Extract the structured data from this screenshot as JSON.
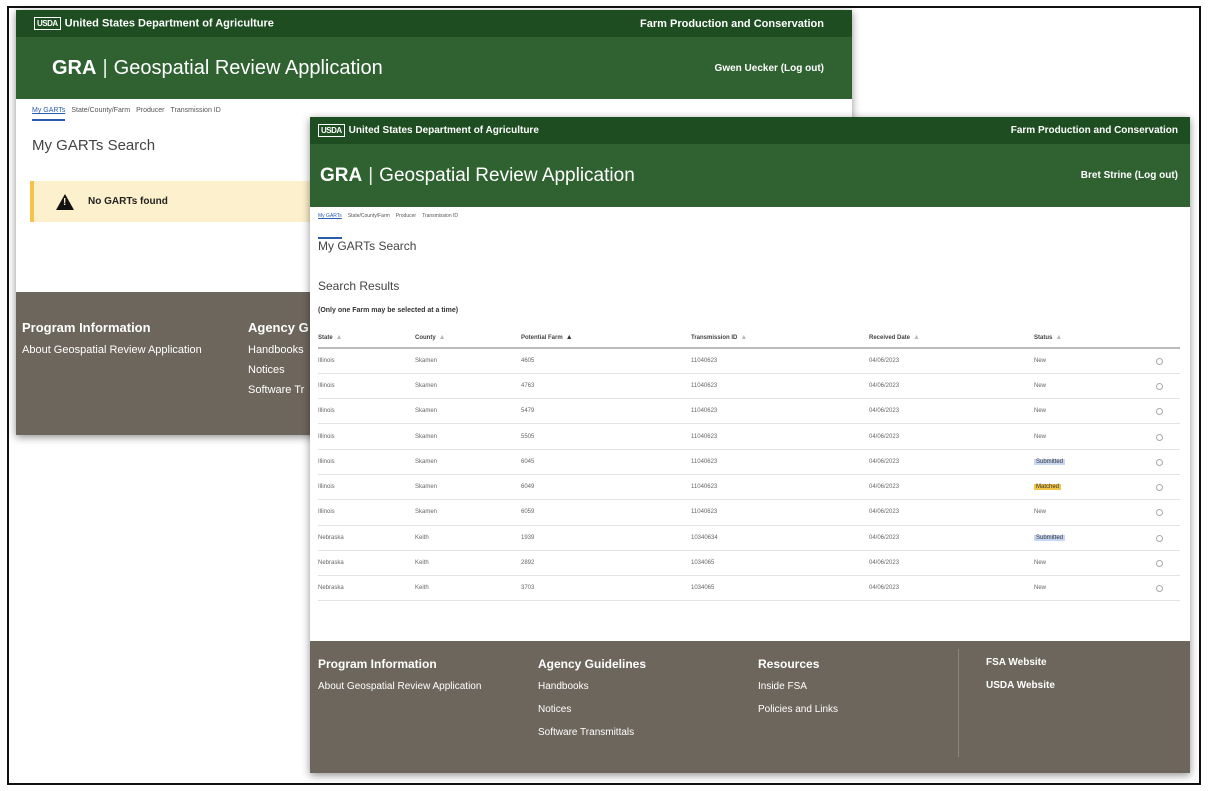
{
  "back": {
    "agency": "United States Department of Agriculture",
    "logo": "USDA",
    "mission_area": "Farm Production and Conservation",
    "brand_short": "GRA",
    "brand_sep": "|",
    "brand_app": "Geospatial Review Application",
    "user": "Gwen Uecker (Log out)",
    "nav": [
      "My GARTs",
      "State/County/Farm",
      "Producer",
      "Transmission ID"
    ],
    "page_title": "My GARTs Search",
    "alert_text": "No GARTs found",
    "footer": {
      "program_head": "Program Information",
      "program_link": "About Geospatial Review Application",
      "agency_head": "Agency G",
      "agency_links": [
        "Handbooks",
        "Notices",
        "Software Tr"
      ]
    }
  },
  "front": {
    "agency": "United States Department of Agriculture",
    "logo": "USDA",
    "mission_area": "Farm Production and Conservation",
    "brand_short": "GRA",
    "brand_sep": "|",
    "brand_app": "Geospatial Review Application",
    "user": "Bret Strine (Log out)",
    "nav": [
      "My GARTs",
      "State/County/Farm",
      "Producer",
      "Transmission ID"
    ],
    "page_title": "My GARTs Search",
    "results_title": "Search Results",
    "note": "(Only one Farm may be selected at a time)",
    "columns": [
      "State",
      "County",
      "Potential Farm",
      "Transmission ID",
      "Received Date",
      "Status"
    ],
    "rows": [
      {
        "state": "Illinois",
        "county": "Skamen",
        "farm": "4605",
        "tid": "11040623",
        "date": "04/06/2023",
        "status": "New",
        "kind": "new"
      },
      {
        "state": "Illinois",
        "county": "Skamen",
        "farm": "4763",
        "tid": "11040623",
        "date": "04/06/2023",
        "status": "New",
        "kind": "new"
      },
      {
        "state": "Illinois",
        "county": "Skamen",
        "farm": "5479",
        "tid": "11040623",
        "date": "04/06/2023",
        "status": "New",
        "kind": "new"
      },
      {
        "state": "Illinois",
        "county": "Skamen",
        "farm": "5505",
        "tid": "11040623",
        "date": "04/06/2023",
        "status": "New",
        "kind": "new"
      },
      {
        "state": "Illinois",
        "county": "Skamen",
        "farm": "6045",
        "tid": "11040623",
        "date": "04/06/2023",
        "status": "Submitted",
        "kind": "submitted"
      },
      {
        "state": "Illinois",
        "county": "Skamen",
        "farm": "6049",
        "tid": "11040623",
        "date": "04/06/2023",
        "status": "Matched",
        "kind": "matched"
      },
      {
        "state": "Illinois",
        "county": "Skamen",
        "farm": "6059",
        "tid": "11040623",
        "date": "04/06/2023",
        "status": "New",
        "kind": "new"
      },
      {
        "state": "Nebraska",
        "county": "Keith",
        "farm": "1939",
        "tid": "10340634",
        "date": "04/06/2023",
        "status": "Submitted",
        "kind": "submitted"
      },
      {
        "state": "Nebraska",
        "county": "Keith",
        "farm": "2892",
        "tid": "1034065",
        "date": "04/06/2023",
        "status": "New",
        "kind": "new"
      },
      {
        "state": "Nebraska",
        "county": "Keith",
        "farm": "3703",
        "tid": "1034065",
        "date": "04/06/2023",
        "status": "New",
        "kind": "new"
      }
    ],
    "footer": {
      "program_head": "Program Information",
      "program_link": "About Geospatial Review Application",
      "agency_head": "Agency Guidelines",
      "agency_links": [
        "Handbooks",
        "Notices",
        "Software Transmittals"
      ],
      "resources_head": "Resources",
      "resources_links": [
        "Inside FSA",
        "Policies and Links"
      ],
      "site_links": [
        "FSA Website",
        "USDA Website"
      ]
    }
  },
  "colors": {
    "topbar": "#1d4d20",
    "hero": "#2f6131",
    "footer": "#6d665c",
    "alert_bg": "#fdf0cc",
    "submitted": "#c7d7f4",
    "matched": "#f3c64a",
    "link": "#2a5db0"
  },
  "icons": {
    "alert": "warning-triangle-icon",
    "sort": "sort-arrow-icon",
    "select": "radio-icon"
  }
}
